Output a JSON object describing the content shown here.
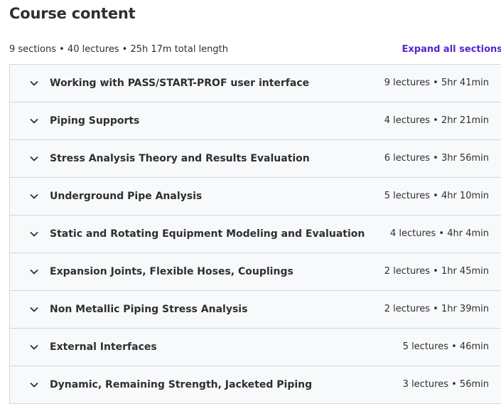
{
  "header": {
    "title": "Course content",
    "summary": "9 sections • 40 lectures • 25h 17m total length",
    "expand_all_label": "Expand all sections"
  },
  "sections": [
    {
      "title": "Working with PASS/START-PROF user interface",
      "info": "9 lectures • 5hr 41min",
      "icon": "chevron-down-icon"
    },
    {
      "title": "Piping Supports",
      "info": "4 lectures • 2hr 21min",
      "icon": "chevron-down-icon"
    },
    {
      "title": "Stress Analysis Theory and Results Evaluation",
      "info": "6 lectures • 3hr 56min",
      "icon": "chevron-down-icon"
    },
    {
      "title": "Underground Pipe Analysis",
      "info": "5 lectures • 4hr 10min",
      "icon": "chevron-down-icon"
    },
    {
      "title": "Static and Rotating Equipment Modeling and Evaluation",
      "info": "4 lectures • 4hr 4min",
      "icon": "chevron-down-icon"
    },
    {
      "title": "Expansion Joints, Flexible Hoses, Couplings",
      "info": "2 lectures • 1hr 45min",
      "icon": "chevron-down-icon"
    },
    {
      "title": "Non Metallic Piping Stress Analysis",
      "info": "2 lectures • 1hr 39min",
      "icon": "chevron-down-icon"
    },
    {
      "title": "External Interfaces",
      "info": "5 lectures • 46min",
      "icon": "chevron-down-icon"
    },
    {
      "title": "Dynamic, Remaining Strength, Jacketed Piping",
      "info": "3 lectures • 56min",
      "icon": "chevron-down-icon"
    }
  ],
  "colors": {
    "accent": "#5624d0",
    "text": "#2d2f31",
    "row_bg": "#f7f9fa",
    "border": "#d1d7dc"
  }
}
